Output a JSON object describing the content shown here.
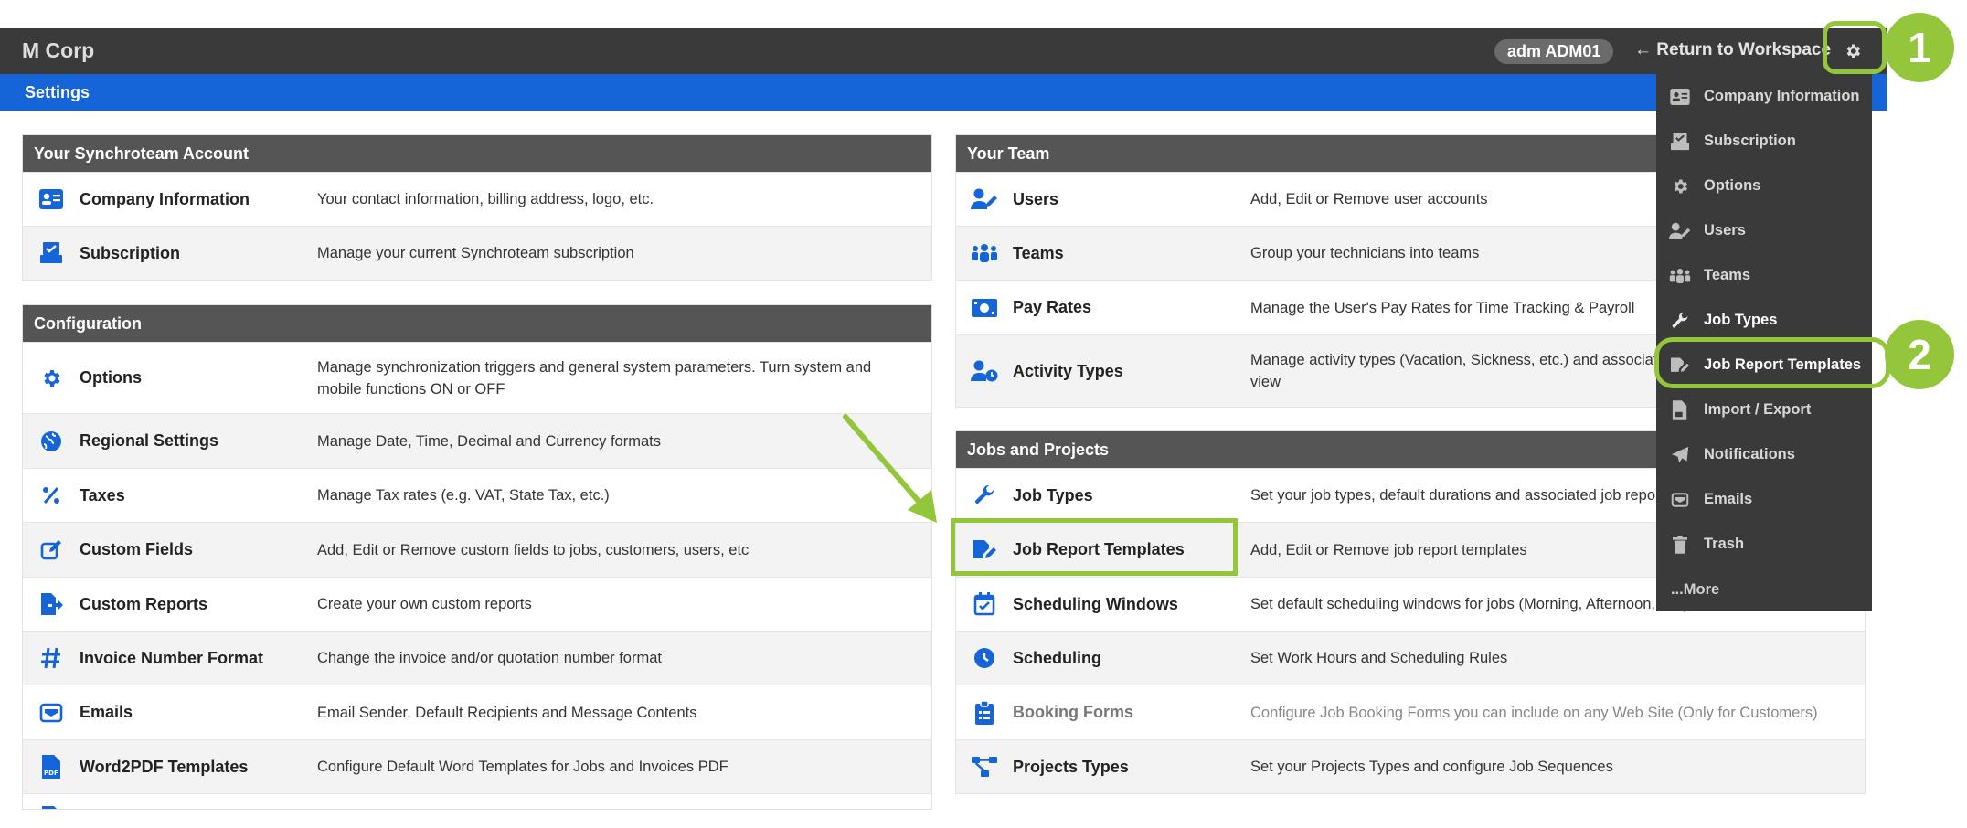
{
  "topbar": {
    "brand": "M Corp",
    "user_badge": "adm ADM01",
    "return_label": "← Return to Workspace",
    "gear_icon": "gear-icon"
  },
  "settings_bar": {
    "title": "Settings"
  },
  "account_panel": {
    "title": "Your Synchroteam Account",
    "rows": [
      {
        "name": "Company Information",
        "desc": "Your contact information, billing address, logo, etc.",
        "icon": "id-card-icon"
      },
      {
        "name": "Subscription",
        "desc": "Manage your current Synchroteam subscription",
        "icon": "subscription-icon"
      }
    ]
  },
  "config_panel": {
    "title": "Configuration",
    "rows": [
      {
        "name": "Options",
        "desc": "Manage synchronization triggers and general system parameters. Turn system and mobile functions ON or OFF",
        "icon": "gear-icon"
      },
      {
        "name": "Regional Settings",
        "desc": "Manage Date, Time, Decimal and Currency formats",
        "icon": "globe-icon"
      },
      {
        "name": "Taxes",
        "desc": "Manage Tax rates (e.g. VAT, State Tax, etc.)",
        "icon": "percent-icon"
      },
      {
        "name": "Custom Fields",
        "desc": "Add, Edit or Remove custom fields to jobs, customers, users, etc",
        "icon": "edit-icon"
      },
      {
        "name": "Custom Reports",
        "desc": "Create your own custom reports",
        "icon": "file-export-icon"
      },
      {
        "name": "Invoice Number Format",
        "desc": "Change the invoice and/or quotation number format",
        "icon": "hash-icon"
      },
      {
        "name": "Emails",
        "desc": "Email Sender, Default Recipients and Message Contents",
        "icon": "envelope-icon"
      },
      {
        "name": "Word2PDF Templates",
        "desc": "Configure Default Word Templates for Jobs and Invoices PDF",
        "icon": "pdf-icon"
      }
    ]
  },
  "team_panel": {
    "title": "Your Team",
    "rows": [
      {
        "name": "Users",
        "desc": "Add, Edit or Remove user accounts",
        "icon": "user-edit-icon"
      },
      {
        "name": "Teams",
        "desc": "Group your technicians into teams",
        "icon": "team-icon"
      },
      {
        "name": "Pay Rates",
        "desc": "Manage the User's Pay Rates for Time Tracking & Payroll",
        "icon": "money-icon"
      },
      {
        "name": "Activity Types",
        "desc": "Manage activity types (Vacation, Sickness, etc.) and associated colors on the planning view",
        "icon": "user-clock-icon"
      }
    ]
  },
  "jobs_panel": {
    "title": "Jobs and Projects",
    "rows": [
      {
        "name": "Job Types",
        "desc": "Set your job types, default durations and associated job report templates",
        "icon": "wrench-icon"
      },
      {
        "name": "Job Report Templates",
        "desc": "Add, Edit or Remove job report templates",
        "icon": "report-edit-icon"
      },
      {
        "name": "Scheduling Windows",
        "desc": "Set default scheduling windows for jobs (Morning, Afternoon, etc.)",
        "icon": "calendar-check-icon"
      },
      {
        "name": "Scheduling",
        "desc": "Set Work Hours and Scheduling Rules",
        "icon": "clock-icon"
      },
      {
        "name": "Booking Forms",
        "desc": "Configure Job Booking Forms you can include on any Web Site (Only for Customers)",
        "icon": "clipboard-icon"
      },
      {
        "name": "Projects Types",
        "desc": "Set your Projects Types and configure Job Sequences",
        "icon": "project-diagram-icon"
      }
    ]
  },
  "dropdown": {
    "items": [
      {
        "label": "Company Information",
        "icon": "id-card-icon"
      },
      {
        "label": "Subscription",
        "icon": "subscription-icon"
      },
      {
        "label": "Options",
        "icon": "gear-icon"
      },
      {
        "label": "Users",
        "icon": "user-edit-icon"
      },
      {
        "label": "Teams",
        "icon": "team-icon"
      },
      {
        "label": "Job Types",
        "icon": "wrench-icon"
      },
      {
        "label": "Job Report Templates",
        "icon": "report-edit-icon"
      },
      {
        "label": "Import / Export",
        "icon": "import-export-icon"
      },
      {
        "label": "Notifications",
        "icon": "paper-plane-icon"
      },
      {
        "label": "Emails",
        "icon": "envelope-icon"
      },
      {
        "label": "Trash",
        "icon": "trash-icon"
      }
    ],
    "more_label": "...More"
  },
  "callouts": {
    "one": "1",
    "two": "2"
  },
  "colors": {
    "accent_blue": "#1565d8",
    "callout_green": "#93c63a",
    "topbar": "#3a3a3a"
  }
}
